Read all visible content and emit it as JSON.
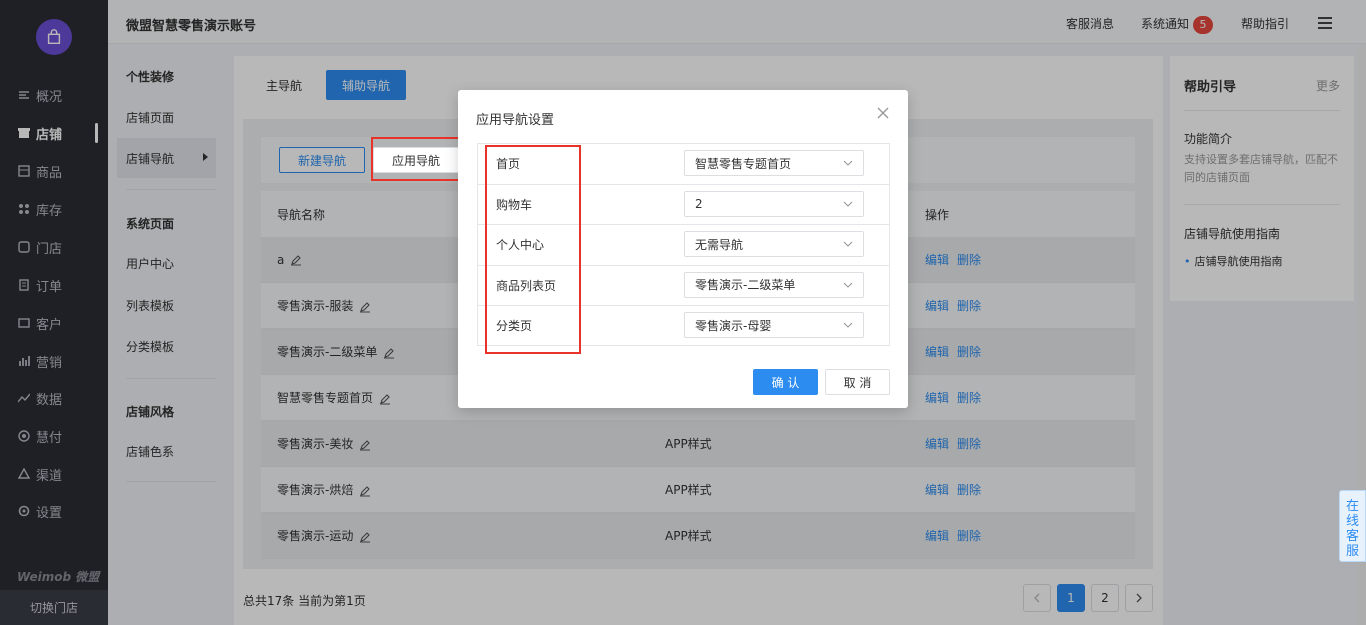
{
  "sidebar": {
    "items": [
      {
        "label": "概况",
        "icon": "overview-icon"
      },
      {
        "label": "店铺",
        "icon": "store-icon",
        "active": true
      },
      {
        "label": "商品",
        "icon": "goods-icon"
      },
      {
        "label": "库存",
        "icon": "inventory-icon"
      },
      {
        "label": "门店",
        "icon": "shop-icon"
      },
      {
        "label": "订单",
        "icon": "order-icon"
      },
      {
        "label": "客户",
        "icon": "customer-icon"
      },
      {
        "label": "营销",
        "icon": "marketing-icon"
      },
      {
        "label": "数据",
        "icon": "data-icon"
      },
      {
        "label": "慧付",
        "icon": "pay-icon"
      },
      {
        "label": "渠道",
        "icon": "channel-icon"
      },
      {
        "label": "设置",
        "icon": "settings-icon"
      }
    ],
    "brand": "Weimob 微盟",
    "switch_store": "切换门店"
  },
  "subnav": {
    "groups": [
      {
        "title": "个性装修",
        "items": [
          "店铺页面",
          "店铺导航"
        ]
      },
      {
        "title": "系统页面",
        "items": [
          "用户中心",
          "列表模板",
          "分类模板"
        ]
      },
      {
        "title": "店铺风格",
        "items": [
          "店铺色系"
        ]
      }
    ]
  },
  "header": {
    "account": "微盟智慧零售演示账号",
    "service_msg": "客服消息",
    "system_notice": "系统通知",
    "notice_count": "5",
    "help": "帮助指引"
  },
  "main": {
    "tabs": [
      "主导航",
      "辅助导航"
    ],
    "new_nav": "新建导航",
    "apply_nav": "应用导航",
    "columns": {
      "name": "导航名称",
      "ops": "操作"
    },
    "rows": [
      {
        "name": "a",
        "style": ""
      },
      {
        "name": "零售演示-服装",
        "style": ""
      },
      {
        "name": "零售演示-二级菜单",
        "style": ""
      },
      {
        "name": "智慧零售专题首页",
        "style": ""
      },
      {
        "name": "零售演示-美妆",
        "style": "APP样式"
      },
      {
        "name": "零售演示-烘焙",
        "style": "APP样式"
      },
      {
        "name": "零售演示-运动",
        "style": "APP样式"
      }
    ],
    "edit": "编辑",
    "delete": "删除",
    "footer": "总共17条 当前为第1页",
    "pages": [
      "1",
      "2"
    ]
  },
  "help": {
    "title": "帮助引导",
    "more": "更多",
    "section1_title": "功能简介",
    "section1_text": "支持设置多套店铺导航，匹配不同的店铺页面",
    "section2_title": "店铺导航使用指南",
    "section2_link": "店铺导航使用指南"
  },
  "online_service": "在线客服",
  "modal": {
    "title": "应用导航设置",
    "rows": [
      {
        "label": "首页",
        "value": "智慧零售专题首页"
      },
      {
        "label": "购物车",
        "value": "2"
      },
      {
        "label": "个人中心",
        "value": "无需导航"
      },
      {
        "label": "商品列表页",
        "value": "零售演示-二级菜单"
      },
      {
        "label": "分类页",
        "value": "零售演示-母婴"
      }
    ],
    "confirm": "确 认",
    "cancel": "取 消"
  },
  "colors": {
    "primary": "#2d8cf0",
    "highlight": "#e8332a",
    "badge": "#e6483d"
  }
}
